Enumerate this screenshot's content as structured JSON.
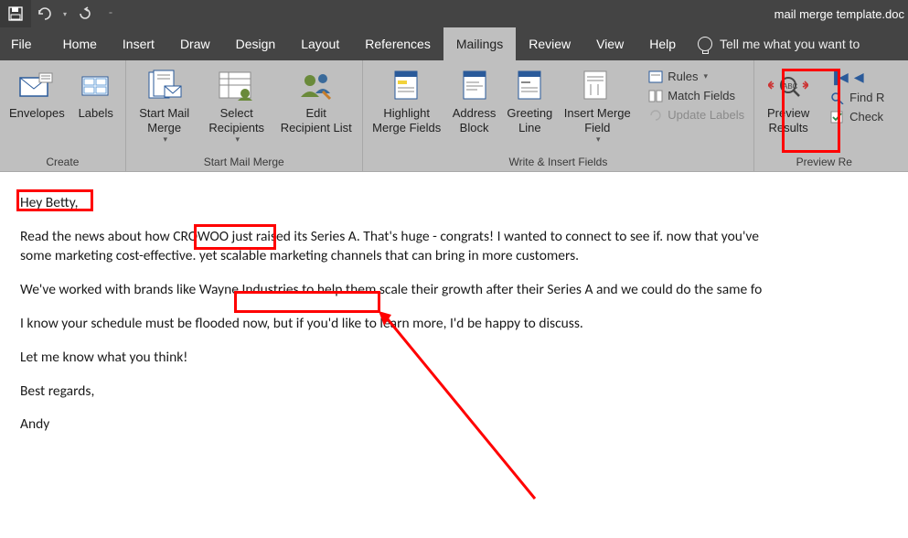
{
  "title": "mail merge template.doc",
  "tabs": {
    "file": "File",
    "home": "Home",
    "insert": "Insert",
    "draw": "Draw",
    "design": "Design",
    "layout": "Layout",
    "references": "References",
    "mailings": "Mailings",
    "review": "Review",
    "view": "View",
    "help": "Help"
  },
  "tellme": "Tell me what you want to",
  "ribbon": {
    "create": {
      "label": "Create",
      "envelopes": "Envelopes",
      "labels": "Labels"
    },
    "startmm": {
      "label": "Start Mail Merge",
      "start": "Start Mail\nMerge",
      "select": "Select\nRecipients",
      "edit": "Edit\nRecipient List"
    },
    "write": {
      "label": "Write & Insert Fields",
      "highlight": "Highlight\nMerge Fields",
      "address": "Address\nBlock",
      "greeting": "Greeting\nLine",
      "insert": "Insert Merge\nField",
      "rules": "Rules",
      "match": "Match Fields",
      "update": "Update Labels"
    },
    "preview": {
      "label": "Preview Re",
      "preview": "Preview\nResults",
      "find": "Find R",
      "check": "Check"
    }
  },
  "doc": {
    "p1_a": "Hey ",
    "p1_b": "Betty",
    "p1_c": ",",
    "p2_a": "Read the news about how ",
    "p2_b": "CROWOO",
    "p2_c": " just raised its Series A. That's huge - congrats! I wanted to connect to see if. now that you've",
    "p2_d": "some marketing cost-effective. yet scalable marketing channels that can bring in more customers.",
    "p3_a": "We've worked with brands like ",
    "p3_b": "Wayne Industries",
    "p3_c": " to help them scale their growth after their Series A and we could do the same fo",
    "p4": "I know your schedule must be flooded now, but if you'd like to learn more, I'd be happy to discuss.",
    "p5": "Let me know what you think!",
    "p6": "Best regards,",
    "p7": "Andy"
  }
}
